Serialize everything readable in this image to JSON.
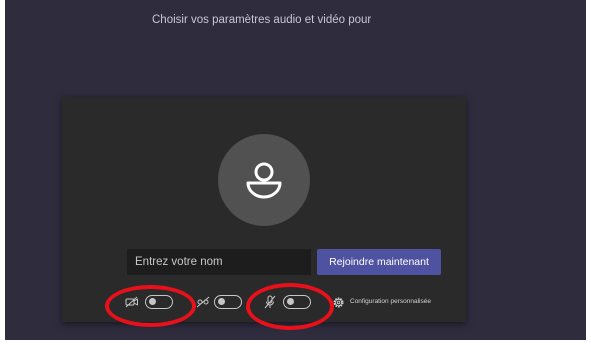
{
  "heading": "Choisir vos paramètres audio et vidéo pour",
  "name_input": {
    "placeholder": "Entrez votre nom",
    "value": ""
  },
  "join_button": {
    "label": "Rejoindre maintenant"
  },
  "controls": {
    "camera": {
      "icon": "camera-off-icon",
      "state": "off"
    },
    "blur": {
      "icon": "background-blur-icon",
      "state": "off"
    },
    "microphone": {
      "icon": "microphone-off-icon",
      "state": "off"
    },
    "custom_settings": {
      "icon": "gear-icon",
      "label": "Configuration personnalisée"
    }
  },
  "annotations": {
    "highlight_color": "#e8101a"
  },
  "colors": {
    "background": "#2e2c3d",
    "card": "#2a2a2a",
    "accent": "#4f52a0"
  }
}
